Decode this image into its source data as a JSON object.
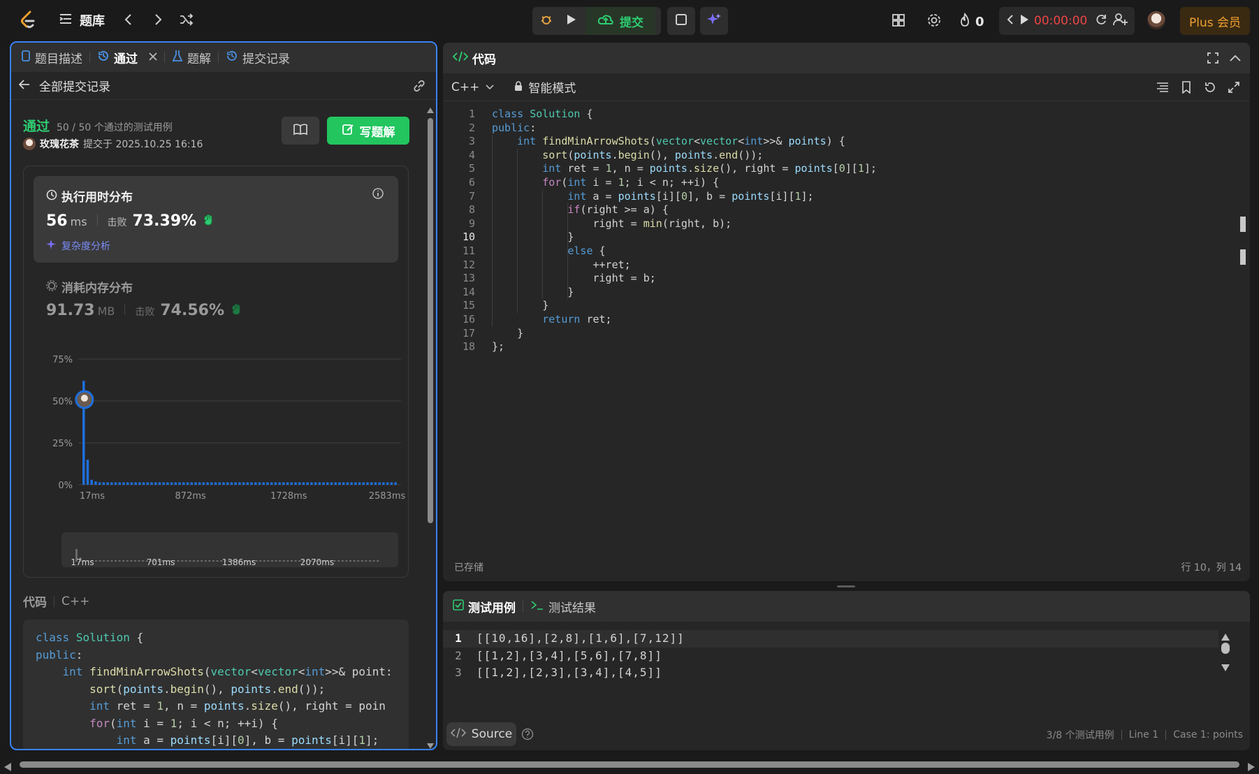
{
  "topbar": {
    "problem_list_label": "题库",
    "submit_label": "提交",
    "fire_count": "0",
    "timer": "00:00:00",
    "plus_label": "Plus 会员"
  },
  "left": {
    "tabs": [
      {
        "label": "题目描述"
      },
      {
        "label": "通过"
      },
      {
        "label": "题解"
      },
      {
        "label": "提交记录"
      }
    ],
    "back_label": "全部提交记录",
    "status": "通过",
    "testcases": "50 / 50 个通过的测试用例",
    "user": "玫瑰花茶",
    "submitted_at": "提交于 2025.10.25 16:16",
    "write_solution": "写题解",
    "runtime": {
      "title": "执行用时分布",
      "value": "56",
      "unit": "ms",
      "beats_label": "击败",
      "beats": "73.39%",
      "analysis": "复杂度分析"
    },
    "memory": {
      "title": "消耗内存分布",
      "value": "91.73",
      "unit": "MB",
      "beats_label": "击败",
      "beats": "74.56%"
    },
    "code_label": "代码",
    "code_lang": "C++",
    "code_preview": [
      "class Solution {",
      "public:",
      "    int findMinArrowShots(vector<vector<int>>& point:",
      "        sort(points.begin(), points.end());",
      "        int ret = 1, n = points.size(), right = poin",
      "        for(int i = 1; i < n; ++i) {",
      "            int a = points[i][0], b = points[i][1];"
    ]
  },
  "chart_data": {
    "type": "bar",
    "y_ticks": [
      "75%",
      "50%",
      "25%",
      "0%"
    ],
    "x_ticks": [
      "17ms",
      "872ms",
      "1728ms",
      "2583ms"
    ],
    "mini_ticks": [
      "17ms",
      "701ms",
      "1386ms",
      "2070ms"
    ],
    "ylim": [
      0,
      75
    ],
    "values": [
      62,
      15,
      3,
      2,
      1.5,
      1.5,
      1.5,
      1.5,
      1.5,
      1.5,
      1.5,
      1.5,
      1.5,
      1.5,
      1.5,
      1.5,
      1.5,
      1.5,
      1.5,
      1.5,
      1.5,
      1.5,
      1.5,
      1.5,
      1.5,
      1.5,
      1.5,
      1.5,
      1.5,
      1.5,
      1.5,
      1.5,
      1.5,
      1.5,
      1.5,
      1.5,
      1.5,
      1.5,
      1.5,
      1.5,
      1.5,
      1.5,
      1.5,
      1.5,
      1.5,
      1.5,
      1.5,
      1.5,
      1.5,
      1.5,
      1.5,
      1.5,
      1.5,
      1.5,
      1.5,
      1.5,
      1.5,
      1.5,
      1.5,
      1.5,
      1.5,
      1.5,
      1.5,
      1.5,
      1.5,
      1.5,
      1.5,
      1.5,
      1.5,
      1.5,
      1.5,
      1.5,
      1.5,
      1.5,
      1.5,
      1.5,
      1.5,
      1.5,
      1.5
    ],
    "highlight_index": 0,
    "color": "#1e6fdb"
  },
  "editor": {
    "title": "代码",
    "lang": "C++",
    "mode": "智能模式",
    "saved": "已存储",
    "cursor": "行 10，列 14",
    "lines": [
      "class Solution {",
      "public:",
      "    int findMinArrowShots(vector<vector<int>>& points) {",
      "        sort(points.begin(), points.end());",
      "        int ret = 1, n = points.size(), right = points[0][1];",
      "        for(int i = 1; i < n; ++i) {",
      "            int a = points[i][0], b = points[i][1];",
      "            if(right >= a) {",
      "                right = min(right, b);",
      "            }",
      "            else {",
      "                ++ret;",
      "                right = b;",
      "            }",
      "        }",
      "        return ret;",
      "    }",
      "};"
    ]
  },
  "testpanel": {
    "tab_cases": "测试用例",
    "tab_results": "测试结果",
    "cases": [
      "[[10,16],[2,8],[1,6],[7,12]]",
      "[[1,2],[3,4],[5,6],[7,8]]",
      "[[1,2],[2,3],[3,4],[4,5]]"
    ],
    "source_label": "Source",
    "footer_count": "3/8 个测试用例",
    "footer_line": "Line 1",
    "footer_case": "Case 1: points"
  }
}
